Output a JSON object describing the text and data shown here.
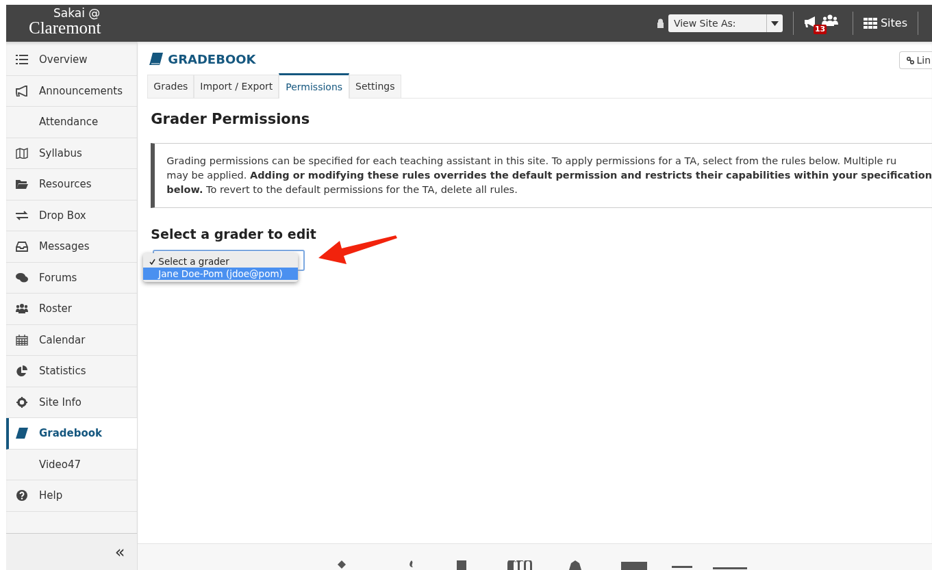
{
  "header": {
    "logo_top": "Sakai @",
    "logo_bottom": "Claremont",
    "view_site_as": "View Site As:",
    "notification_count": "13",
    "sites": "Sites"
  },
  "sidebar": {
    "items": [
      {
        "label": "Overview",
        "selected": false
      },
      {
        "label": "Announcements",
        "selected": false
      },
      {
        "label": "Attendance",
        "selected": false
      },
      {
        "label": "Syllabus",
        "selected": false
      },
      {
        "label": "Resources",
        "selected": false
      },
      {
        "label": "Drop Box",
        "selected": false
      },
      {
        "label": "Messages",
        "selected": false
      },
      {
        "label": "Forums",
        "selected": false
      },
      {
        "label": "Roster",
        "selected": false
      },
      {
        "label": "Calendar",
        "selected": false
      },
      {
        "label": "Statistics",
        "selected": false
      },
      {
        "label": "Site Info",
        "selected": false
      },
      {
        "label": "Gradebook",
        "selected": true
      },
      {
        "label": "Video47",
        "selected": false
      },
      {
        "label": "Help",
        "selected": false
      }
    ],
    "collapse": "«"
  },
  "tool": {
    "title": "GRADEBOOK",
    "link_button": "Lin"
  },
  "tabs": [
    {
      "label": "Grades",
      "selected": false
    },
    {
      "label": "Import / Export",
      "selected": false
    },
    {
      "label": "Permissions",
      "selected": true
    },
    {
      "label": "Settings",
      "selected": false
    }
  ],
  "page_title": "Grader Permissions",
  "info": "Grading permissions can be specified for each teaching assistant in this site. To apply permissions for a TA, select from the rules below. Multiple ru may be applied. **Adding or modifying these rules overrides the default permission and restricts their capabilities within your specification below.** To revert to the default permissions for the TA, delete all rules.",
  "select_heading": "Select a grader to edit",
  "grader_select": {
    "options": [
      {
        "label": "Select a grader",
        "checked": true,
        "highlighted": false
      },
      {
        "label": "Jane Doe-Pom (jdoe@pom)",
        "checked": false,
        "highlighted": true
      }
    ]
  }
}
